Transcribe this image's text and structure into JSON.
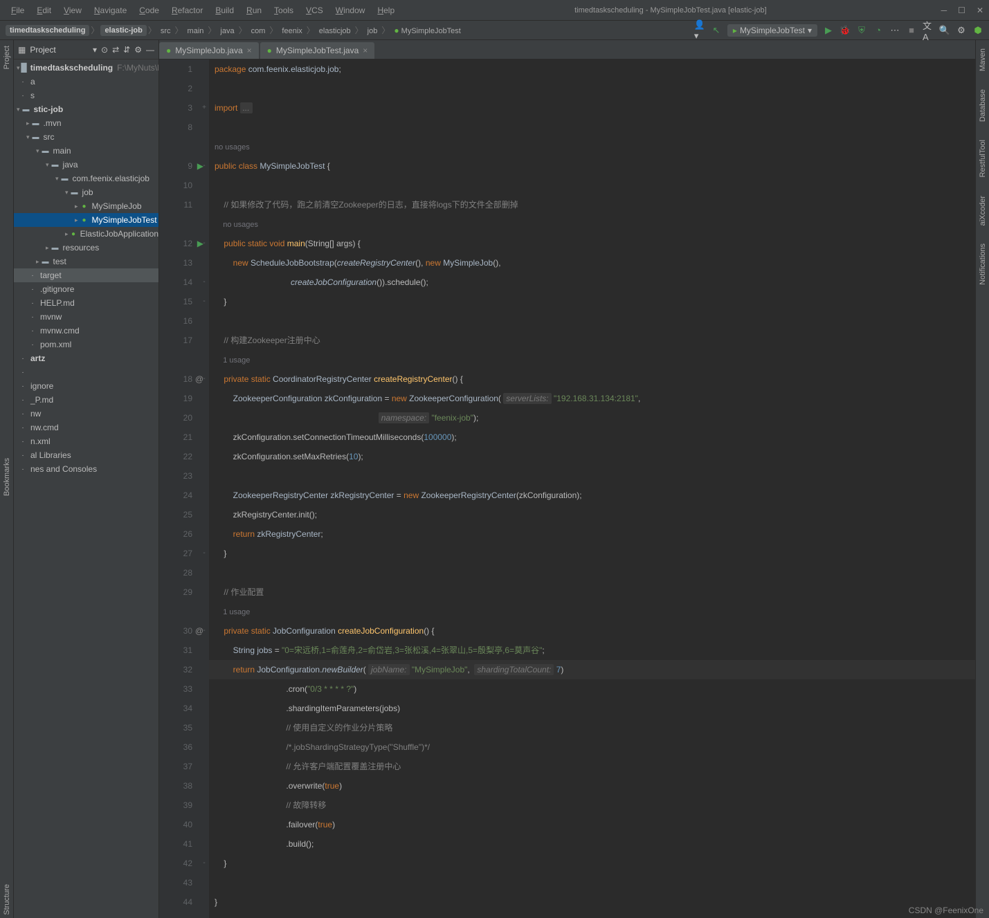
{
  "menu": [
    "File",
    "Edit",
    "View",
    "Navigate",
    "Code",
    "Refactor",
    "Build",
    "Run",
    "Tools",
    "VCS",
    "Window",
    "Help"
  ],
  "window_title": "timedtaskscheduling - MySimpleJobTest.java [elastic-job]",
  "breadcrumbs": {
    "project": "timedtaskscheduling",
    "module": "elastic-job",
    "path": [
      "src",
      "main",
      "java",
      "com",
      "feenix",
      "elasticjob",
      "job",
      "MySimpleJobTest"
    ]
  },
  "run_config": "MySimpleJobTest",
  "project_root": "timedtaskscheduling",
  "project_path": "F:\\MyNuts\\MCA\\co",
  "tree": [
    {
      "t": "a",
      "d": 0
    },
    {
      "t": "s",
      "d": 0
    },
    {
      "t": "stic-job",
      "d": 0,
      "bold": true,
      "exp": true,
      "folder": true
    },
    {
      "t": ".mvn",
      "d": 1,
      "folder": true
    },
    {
      "t": "src",
      "d": 1,
      "folder": true,
      "exp": true
    },
    {
      "t": "main",
      "d": 2,
      "folder": true,
      "exp": true
    },
    {
      "t": "java",
      "d": 3,
      "folder": true,
      "exp": true
    },
    {
      "t": "com.feenix.elasticjob",
      "d": 4,
      "folder": true,
      "exp": true
    },
    {
      "t": "job",
      "d": 5,
      "folder": true,
      "exp": true
    },
    {
      "t": "MySimpleJob",
      "d": 6,
      "java": true
    },
    {
      "t": "MySimpleJobTest",
      "d": 6,
      "java": true,
      "sel": true
    },
    {
      "t": "ElasticJobApplication",
      "d": 5,
      "java": true
    },
    {
      "t": "resources",
      "d": 3,
      "folder": true
    },
    {
      "t": "test",
      "d": 2,
      "folder": true
    },
    {
      "t": "target",
      "d": 1,
      "dim": true
    },
    {
      "t": ".gitignore",
      "d": 1
    },
    {
      "t": "HELP.md",
      "d": 1
    },
    {
      "t": "mvnw",
      "d": 1
    },
    {
      "t": "mvnw.cmd",
      "d": 1
    },
    {
      "t": "pom.xml",
      "d": 1
    },
    {
      "t": "artz",
      "d": 0,
      "bold": true
    },
    {
      "t": " ",
      "d": 0,
      "spacer": true
    },
    {
      "t": "ignore",
      "d": 0
    },
    {
      "t": "_P.md",
      "d": 0
    },
    {
      "t": "nw",
      "d": 0
    },
    {
      "t": "nw.cmd",
      "d": 0
    },
    {
      "t": "n.xml",
      "d": 0
    },
    {
      "t": "al Libraries",
      "d": 0
    },
    {
      "t": "nes and Consoles",
      "d": 0
    }
  ],
  "tabs": [
    {
      "name": "MySimpleJob.java"
    },
    {
      "name": "MySimpleJobTest.java",
      "active": true
    }
  ],
  "left_tabs": [
    "Project",
    "Bookmarks",
    "Structure"
  ],
  "right_tabs": [
    "Maven",
    "Database",
    "RestfulTool",
    "aiXcoder",
    "Notifications"
  ],
  "code": {
    "1": {
      "tokens": [
        [
          "kw",
          "package "
        ],
        [
          "type",
          "com.feenix.elasticjob.job"
        ],
        [
          "",
          ";"
        ]
      ]
    },
    "2": {
      "tokens": []
    },
    "3": {
      "tokens": [
        [
          "kw",
          "import "
        ],
        [
          "hint",
          "..."
        ]
      ],
      "fold": "+"
    },
    "8": {
      "tokens": []
    },
    "8u": {
      "usage": "no usages"
    },
    "9": {
      "tokens": [
        [
          "kw",
          "public class "
        ],
        [
          "type",
          "MySimpleJobTest "
        ],
        [
          "",
          "{"
        ]
      ],
      "run": true,
      "fold": "-"
    },
    "10": {
      "tokens": []
    },
    "11": {
      "tokens": [
        [
          "",
          "    "
        ],
        [
          "com",
          "// 如果修改了代码，跑之前清空Zookeeper的日志，直接将logs下的文件全部删掉"
        ]
      ]
    },
    "11u": {
      "usage": "    no usages"
    },
    "12": {
      "tokens": [
        [
          "",
          "    "
        ],
        [
          "kw",
          "public static void "
        ],
        [
          "fn",
          "main"
        ],
        [
          "",
          "(String[] args) {"
        ]
      ],
      "run": true,
      "fold": "-"
    },
    "13": {
      "tokens": [
        [
          "",
          "        "
        ],
        [
          "kw",
          "new "
        ],
        [
          "type",
          "ScheduleJobBootstrap"
        ],
        [
          "",
          "("
        ],
        [
          "type static-it",
          "createRegistryCenter"
        ],
        [
          "",
          "(), "
        ],
        [
          "kw",
          "new "
        ],
        [
          "type",
          "MySimpleJob"
        ],
        [
          "",
          "(),"
        ]
      ]
    },
    "14": {
      "tokens": [
        [
          "",
          "                                 "
        ],
        [
          "type static-it",
          "createJobConfiguration"
        ],
        [
          "",
          "()).schedule();"
        ]
      ],
      "fold": "-"
    },
    "15": {
      "tokens": [
        [
          "",
          "    }"
        ]
      ],
      "fold": "-"
    },
    "16": {
      "tokens": []
    },
    "17": {
      "tokens": [
        [
          "",
          "    "
        ],
        [
          "com",
          "// 构建Zookeeper注册中心"
        ]
      ]
    },
    "17u": {
      "usage": "    1 usage"
    },
    "18": {
      "tokens": [
        [
          "",
          "    "
        ],
        [
          "kw",
          "private static "
        ],
        [
          "type",
          "CoordinatorRegistryCenter "
        ],
        [
          "fn",
          "createRegistryCenter"
        ],
        [
          "",
          "() {"
        ]
      ],
      "at": "@",
      "fold": "-"
    },
    "19": {
      "tokens": [
        [
          "",
          "        "
        ],
        [
          "type",
          "ZookeeperConfiguration zkConfiguration "
        ],
        [
          "",
          "= "
        ],
        [
          "kw",
          "new "
        ],
        [
          "type",
          "ZookeeperConfiguration"
        ],
        [
          "",
          "( "
        ],
        [
          "hint",
          "serverLists:"
        ],
        [
          "type",
          " "
        ],
        [
          "str",
          "\"192.168.31.134:2181\""
        ],
        [
          "",
          ","
        ]
      ]
    },
    "20": {
      "tokens": [
        [
          "",
          "                                                                       "
        ],
        [
          "hint",
          "namespace:"
        ],
        [
          "type",
          " "
        ],
        [
          "str",
          "\"feenix-job\""
        ],
        [
          "",
          ");"
        ]
      ]
    },
    "21": {
      "tokens": [
        [
          "",
          "        zkConfiguration.setConnectionTimeoutMilliseconds("
        ],
        [
          "num",
          "100000"
        ],
        [
          "",
          ");"
        ]
      ]
    },
    "22": {
      "tokens": [
        [
          "",
          "        zkConfiguration.setMaxRetries("
        ],
        [
          "num",
          "10"
        ],
        [
          "",
          ");"
        ]
      ]
    },
    "23": {
      "tokens": []
    },
    "24": {
      "tokens": [
        [
          "",
          "        "
        ],
        [
          "type",
          "ZookeeperRegistryCenter zkRegistryCenter "
        ],
        [
          "",
          "= "
        ],
        [
          "kw",
          "new "
        ],
        [
          "type",
          "ZookeeperRegistryCenter"
        ],
        [
          "",
          "(zkConfiguration);"
        ]
      ]
    },
    "25": {
      "tokens": [
        [
          "",
          "        zkRegistryCenter.init();"
        ]
      ]
    },
    "26": {
      "tokens": [
        [
          "",
          "        "
        ],
        [
          "kw",
          "return "
        ],
        [
          "type",
          "zkRegistryCenter"
        ],
        [
          "",
          ";"
        ]
      ]
    },
    "27": {
      "tokens": [
        [
          "",
          "    }"
        ]
      ],
      "fold": "-"
    },
    "28": {
      "tokens": []
    },
    "29": {
      "tokens": [
        [
          "",
          "    "
        ],
        [
          "com",
          "// 作业配置"
        ]
      ]
    },
    "29u": {
      "usage": "    1 usage"
    },
    "30": {
      "tokens": [
        [
          "",
          "    "
        ],
        [
          "kw",
          "private static "
        ],
        [
          "type",
          "JobConfiguration "
        ],
        [
          "fn",
          "createJobConfiguration"
        ],
        [
          "",
          "() {"
        ]
      ],
      "at": "@",
      "fold": "-"
    },
    "31": {
      "tokens": [
        [
          "",
          "        "
        ],
        [
          "type",
          "String jobs "
        ],
        [
          "",
          "= "
        ],
        [
          "str",
          "\"0=宋远桥,1=俞莲舟,2=俞岱岩,3=张松溪,4=张翠山,5=殷梨亭,6=莫声谷\""
        ],
        [
          "",
          ";"
        ]
      ]
    },
    "32": {
      "tokens": [
        [
          "",
          "        "
        ],
        [
          "kw",
          "return "
        ],
        [
          "type",
          "JobConfiguration."
        ],
        [
          "type static-it",
          "newBuilder"
        ],
        [
          "",
          "( "
        ],
        [
          "hint",
          "jobName:"
        ],
        [
          "type",
          " "
        ],
        [
          "str",
          "\"MySimpleJob\""
        ],
        [
          "",
          ",  "
        ],
        [
          "hint",
          "shardingTotalCount:"
        ],
        [
          "type",
          " "
        ],
        [
          "num",
          "7"
        ],
        [
          "",
          ")"
        ]
      ],
      "hl": true,
      "bulb": true
    },
    "33": {
      "tokens": [
        [
          "",
          "                               .cron("
        ],
        [
          "str",
          "\"0/3 * * * * ?\""
        ],
        [
          "",
          ")"
        ]
      ]
    },
    "34": {
      "tokens": [
        [
          "",
          "                               .shardingItemParameters(jobs)"
        ]
      ]
    },
    "35": {
      "tokens": [
        [
          "",
          "                               "
        ],
        [
          "com",
          "// 使用自定义的作业分片策略"
        ]
      ]
    },
    "36": {
      "tokens": [
        [
          "",
          "                               "
        ],
        [
          "com",
          "/*.jobShardingStrategyType(\"Shuffle\")*/"
        ]
      ]
    },
    "37": {
      "tokens": [
        [
          "",
          "                               "
        ],
        [
          "com",
          "// 允许客户端配置覆盖注册中心"
        ]
      ]
    },
    "38": {
      "tokens": [
        [
          "",
          "                               .overwrite("
        ],
        [
          "kw",
          "true"
        ],
        [
          "",
          ")"
        ]
      ]
    },
    "39": {
      "tokens": [
        [
          "",
          "                               "
        ],
        [
          "com",
          "// 故障转移"
        ]
      ]
    },
    "40": {
      "tokens": [
        [
          "",
          "                               .failover("
        ],
        [
          "kw",
          "true"
        ],
        [
          "",
          ")"
        ]
      ]
    },
    "41": {
      "tokens": [
        [
          "",
          "                               .build();"
        ]
      ]
    },
    "42": {
      "tokens": [
        [
          "",
          "    }"
        ]
      ],
      "fold": "-"
    },
    "43": {
      "tokens": []
    },
    "44": {
      "tokens": [
        [
          "",
          "}"
        ]
      ]
    }
  },
  "line_order": [
    "1",
    "2",
    "3",
    "8",
    "8u",
    "9",
    "10",
    "11",
    "11u",
    "12",
    "13",
    "14",
    "15",
    "16",
    "17",
    "17u",
    "18",
    "19",
    "20",
    "21",
    "22",
    "23",
    "24",
    "25",
    "26",
    "27",
    "28",
    "29",
    "29u",
    "30",
    "31",
    "32",
    "33",
    "34",
    "35",
    "36",
    "37",
    "38",
    "39",
    "40",
    "41",
    "42",
    "43",
    "44"
  ],
  "watermark": "CSDN @FeenixOne"
}
